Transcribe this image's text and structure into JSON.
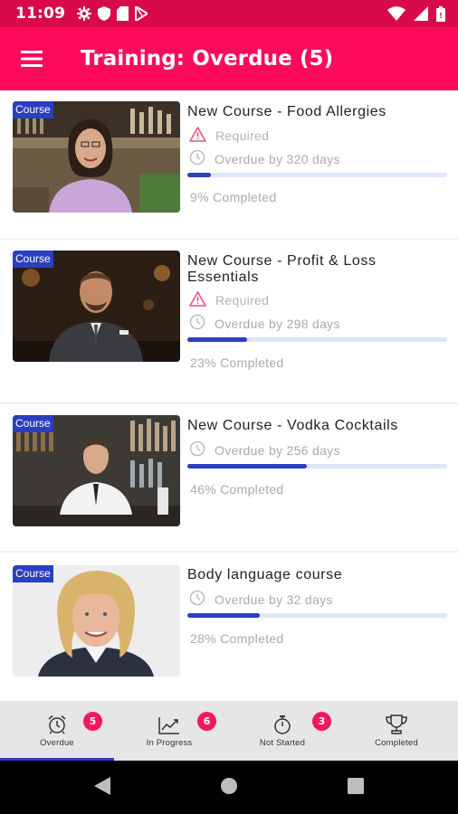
{
  "status_bar": {
    "time": "11:09",
    "background": "#d80a4a",
    "left_icons": [
      "gear-icon",
      "shield-icon",
      "sd-card-icon",
      "play-store-icon"
    ],
    "right_icons": [
      "wifi-icon",
      "signal-icon",
      "battery-icon"
    ]
  },
  "app_bar": {
    "title": "Training: Overdue (5)",
    "background": "#fc0b5b",
    "menu_icon": "hamburger-menu-icon"
  },
  "courses": [
    {
      "badge": "Course",
      "title_lines": [
        "New Course - Food Allergies"
      ],
      "required": "Required",
      "overdue": "Overdue by 320 days",
      "progress": 0.09,
      "completed_text": "9% Completed",
      "thumbnail": "woman-in-lilac-sweater-bar-background"
    },
    {
      "badge": "Course",
      "title_lines": [
        "New Course - Profit & Loss",
        "Essentials"
      ],
      "required": "Required",
      "overdue": "Overdue by 298 days",
      "progress": 0.23,
      "completed_text": "23% Completed",
      "thumbnail": "man-in-suit-dark-background"
    },
    {
      "badge": "Course",
      "title_lines": [
        "New Course - Vodka Cocktails"
      ],
      "required": null,
      "overdue": "Overdue by 256 days",
      "progress": 0.46,
      "completed_text": "46% Completed",
      "thumbnail": "bartender-white-jacket-bar"
    },
    {
      "badge": "Course",
      "title_lines": [
        "Body language course"
      ],
      "required": null,
      "overdue": "Overdue by 32 days",
      "progress": 0.28,
      "completed_text": "28% Completed",
      "thumbnail": "blond-man-portrait"
    }
  ],
  "tabs": [
    {
      "label": "Overdue",
      "badge": "5",
      "icon": "alarm-clock-icon",
      "active": true
    },
    {
      "label": "In Progress",
      "badge": "6",
      "icon": "trending-chart-icon",
      "active": false
    },
    {
      "label": "Not Started",
      "badge": "3",
      "icon": "stopwatch-icon",
      "active": false
    },
    {
      "label": "Completed",
      "badge": null,
      "icon": "trophy-icon",
      "active": false
    }
  ],
  "colors": {
    "accent": "#fc0b5b",
    "progress": "#2a3fc1",
    "badge": "#f21759"
  }
}
